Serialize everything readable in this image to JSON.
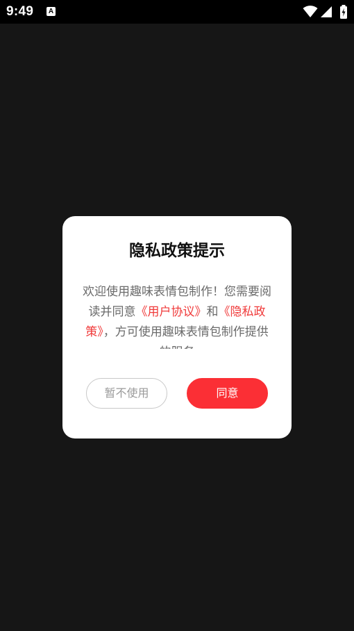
{
  "status_bar": {
    "time": "9:49",
    "notification_icon_letter": "A",
    "icons": [
      "wifi-icon",
      "cell-signal-icon",
      "battery-charging-icon"
    ]
  },
  "dialog": {
    "title": "隐私政策提示",
    "body": {
      "text_before": "欢迎使用趣味表情包制作！您需要阅读并同意",
      "user_agreement_link": "《用户协议》",
      "conjunction": "和",
      "privacy_policy_link": "《隐私政策》",
      "text_after": "，方可使用趣味表情包制作提供的服务"
    },
    "decline_button": "暂不使用",
    "agree_button": "同意"
  },
  "colors": {
    "accent": "#fb2f35",
    "link": "#f03a3a",
    "background": "#161616",
    "dialog": "#ffffff",
    "body_text": "#6a6a6a"
  }
}
